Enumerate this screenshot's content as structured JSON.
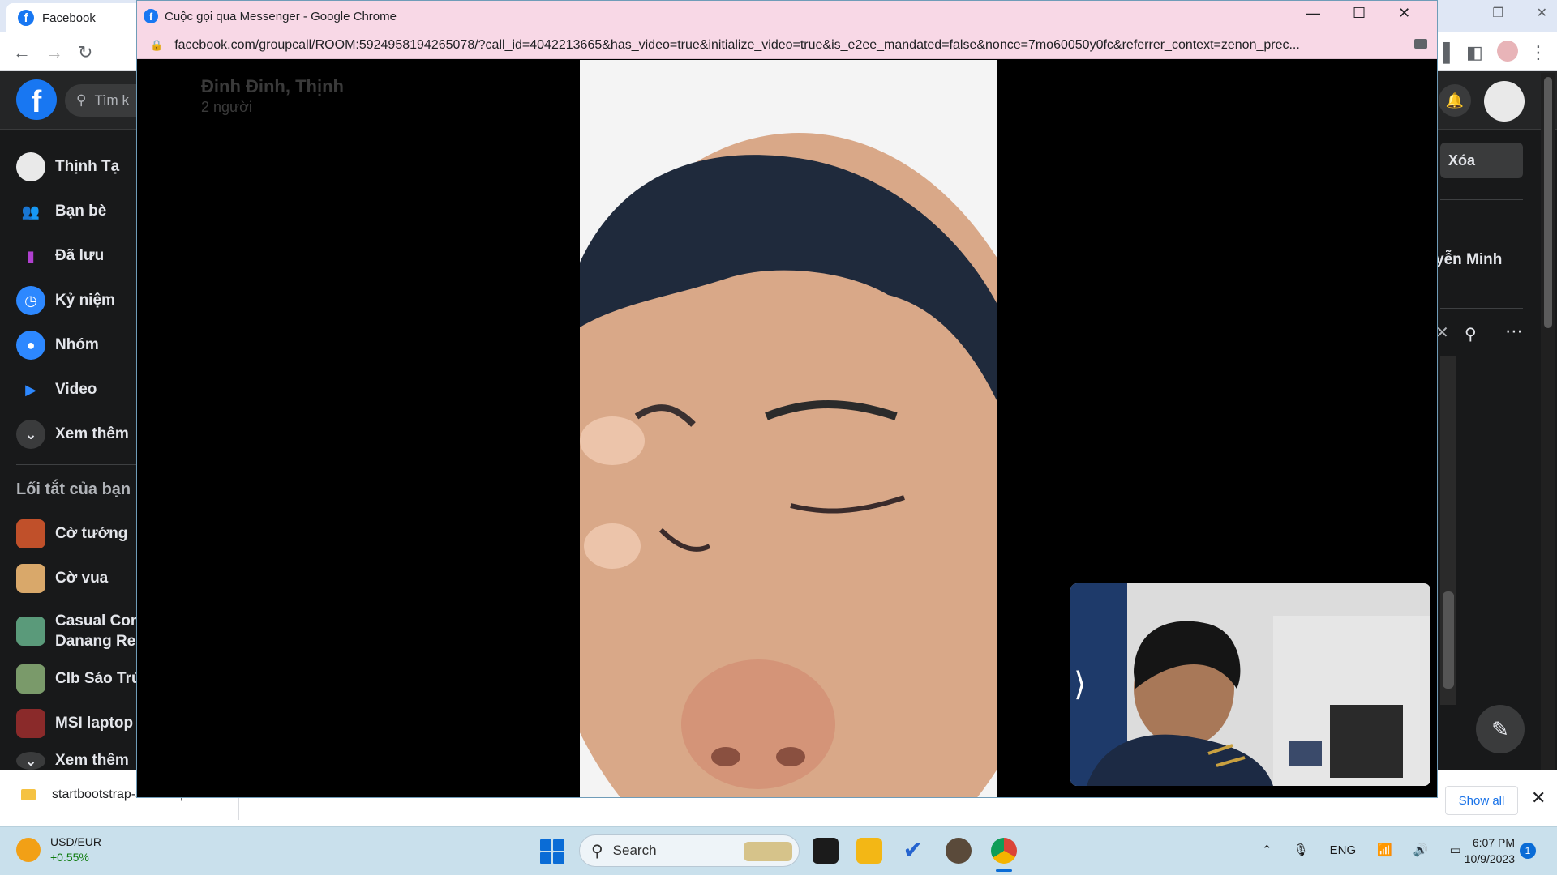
{
  "bg_browser": {
    "tab_title": "Facebook"
  },
  "facebook": {
    "search_placeholder": "Tìm k",
    "sidebar": [
      {
        "label": "Thịnh Tạ",
        "icon": "avatar-icon"
      },
      {
        "label": "Bạn bè",
        "icon": "friends-icon"
      },
      {
        "label": "Đã lưu",
        "icon": "bookmark-icon"
      },
      {
        "label": "Kỷ niệm",
        "icon": "memories-clock-icon"
      },
      {
        "label": "Nhóm",
        "icon": "groups-icon"
      },
      {
        "label": "Video",
        "icon": "video-play-icon"
      },
      {
        "label": "Xem thêm",
        "icon": "chevron-down-icon"
      }
    ],
    "shortcuts_title": "Lối tắt của bạn",
    "shortcuts": [
      {
        "label": "Cờ tướng"
      },
      {
        "label": "Cờ vua"
      },
      {
        "label": "Casual Com",
        "label2": "Danang Res"
      },
      {
        "label": "Clb Sáo Trúc"
      },
      {
        "label": "MSI laptop V"
      },
      {
        "label": "Xem thêm"
      }
    ],
    "right": {
      "delete_label": "Xóa",
      "contact_name": "yễn Minh"
    }
  },
  "popup": {
    "title": "Cuộc gọi qua Messenger - Google Chrome",
    "url": "facebook.com/groupcall/ROOM:5924958194265078/?call_id=4042213665&has_video=true&initialize_video=true&is_e2ee_mandated=false&nonce=7mo60050y0fc&referrer_context=zenon_prec...",
    "call_participants": "Đinh Đinh, Thịnh",
    "call_count": "2 người"
  },
  "download_bar": {
    "file_name": "startbootstrap-sho....zip",
    "show_all": "Show all"
  },
  "taskbar": {
    "ticker_name": "USD/EUR",
    "ticker_change": "+0.55%",
    "search_label": "Search",
    "language": "ENG",
    "time": "6:07 PM",
    "date": "10/9/2023",
    "notification_count": "1"
  }
}
